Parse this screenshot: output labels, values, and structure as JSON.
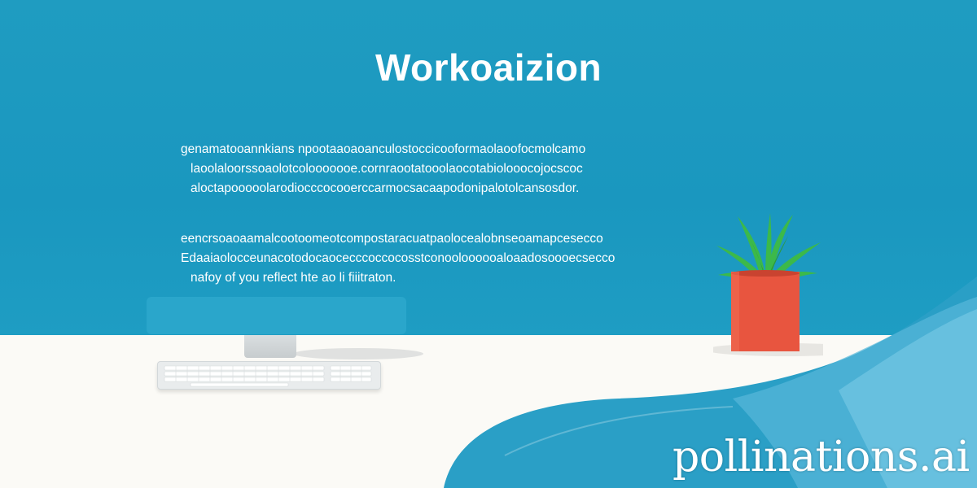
{
  "heading": "Workoaizion",
  "paragraph_1": [
    "genamatooannkians npootaaoaoanculostoccicooformaolaoofocmolcamo",
    "laoolaloorssoaolotcolooooooe.cornraootatooolaocotabiolooocojocscoc",
    "aloctapooooolarodiocccocooerccarmocsacaapodonipalotolcansosdor."
  ],
  "paragraph_2": [
    "eencrsoaoaamalcootoomeotcompostaracuatpaolocealobnseoamapcesecco",
    "Edaaiaolocceunacotodocaocecccoccocosstconooloooooaloaadosoooecsecco",
    "nafoy of you reflect hte ao li fiiitraton."
  ],
  "watermark": "pollinations.ai",
  "colors": {
    "wall": "#1f9cc1",
    "desk": "#fbfaf6",
    "pot": "#e8553f",
    "leaves": "#3cb94a",
    "wave": "#2a9fc6"
  }
}
